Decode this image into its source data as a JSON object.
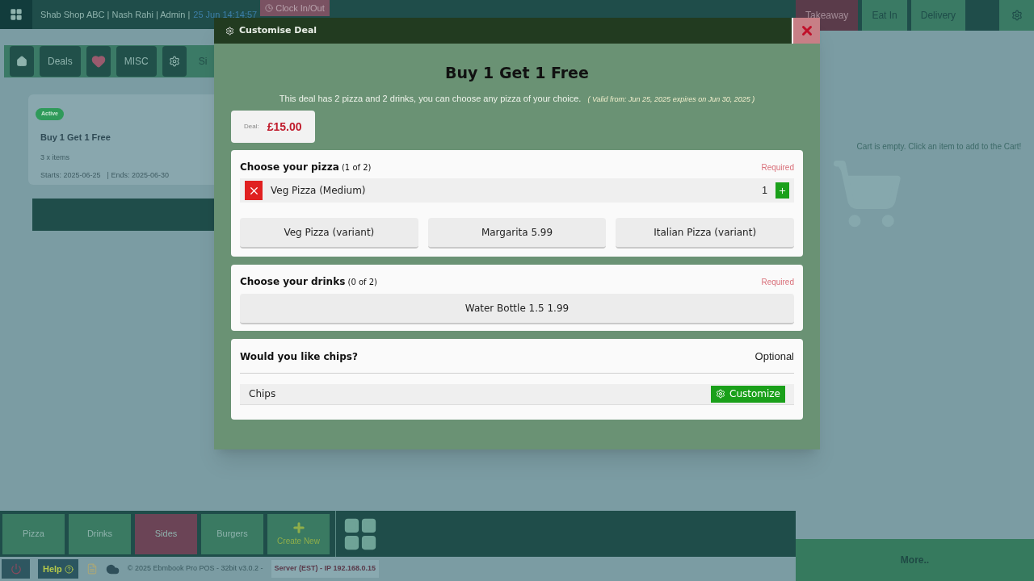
{
  "header": {
    "shop_info": "Shab Shop ABC | Nash Rahi | Admin |",
    "clock": "25 Jun 14:14:57",
    "clock_button": "Clock In/Out"
  },
  "order_types": [
    {
      "label": "Takeaway",
      "selected": true
    },
    {
      "label": "Eat In",
      "selected": false
    },
    {
      "label": "Delivery",
      "selected": false
    }
  ],
  "toolbar": [
    {
      "kind": "home"
    },
    {
      "kind": "text",
      "label": "Deals"
    },
    {
      "kind": "heart"
    },
    {
      "kind": "text",
      "label": "MISC"
    },
    {
      "kind": "gear"
    }
  ],
  "toolbar_cut_label": "Si",
  "deal_card": {
    "badge": "Active",
    "title": "Buy 1 Get 1 Free",
    "items": "3 x items",
    "starts": "Starts: 2025-06-25",
    "ends": "| Ends: 2025-06-30"
  },
  "categories": [
    {
      "label": "Pizza",
      "color": "#3a7a62"
    },
    {
      "label": "Drinks",
      "color": "#3a7a62"
    },
    {
      "label": "Sides",
      "color": "#6b4456"
    },
    {
      "label": "Burgers",
      "color": "#3a7a62"
    }
  ],
  "create_new": "Create New",
  "footer": {
    "help": "Help",
    "copyright": "© 2025 Ebmbook Pro POS - 32bit v3.0.2 -",
    "server": "Server (EST) - IP 192.168.0.15"
  },
  "cart": {
    "empty_text": "Cart is empty. Click an item to add to the Cart!",
    "more": "More.."
  },
  "dialog": {
    "title": "Customise Deal",
    "heading": "Buy 1 Get 1 Free",
    "description": "This deal has 2 pizza and 2 drinks, you can choose any pizza of your choice.",
    "validity": "( Valid from: Jun 25, 2025 expires on Jun 30, 2025 )",
    "price_label": "Deal:",
    "price": "£15.00",
    "groups": [
      {
        "kind": "choice",
        "title": "Choose your pizza",
        "count": "(1 of 2)",
        "requirement": "Required",
        "selected_items": [
          {
            "name": "Veg Pizza (Medium)",
            "quantity": "1"
          }
        ],
        "options": [
          "Veg Pizza (variant)",
          "Margarita 5.99",
          "Italian Pizza (variant)"
        ]
      },
      {
        "kind": "choice",
        "title": "Choose your drinks",
        "count": "(0 of 2)",
        "requirement": "Required",
        "options": [
          "Water Bottle 1.5 1.99"
        ]
      },
      {
        "kind": "optional",
        "title": "Would you like chips?",
        "requirement": "Optional",
        "items": [
          {
            "name": "Chips",
            "button": "Customize"
          }
        ]
      }
    ]
  }
}
